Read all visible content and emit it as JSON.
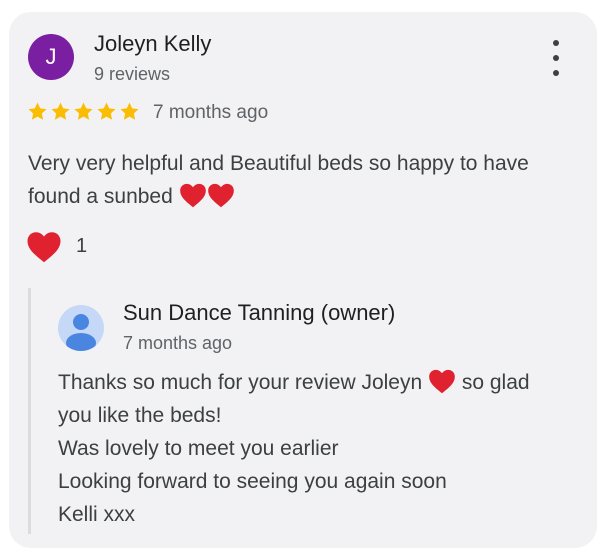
{
  "review": {
    "author_initial": "J",
    "author_name": "Joleyn Kelly",
    "author_meta": "9 reviews",
    "rating": 5,
    "time": "7 months ago",
    "text": "Very very helpful and Beautiful beds so happy to have found a sunbed",
    "reaction_icon": "heart-icon",
    "reaction_count": "1"
  },
  "reply": {
    "owner_name": "Sun Dance Tanning (owner)",
    "time": "7 months ago",
    "line1_before": "Thanks so much for your review Joleyn",
    "line1_after": "so glad you like the beds!",
    "line2": "Was lovely to meet you earlier",
    "line3": "Looking forward to seeing you again soon",
    "line4": "Kelli xxx"
  },
  "colors": {
    "avatar_bg": "#7b1fa2",
    "star": "#fbbc04",
    "heart": "#e0212f"
  }
}
